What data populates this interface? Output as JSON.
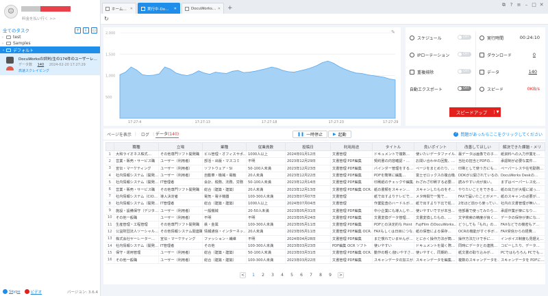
{
  "sidebar": {
    "avatar_glyph": "☺",
    "upgrade_text": "料金を払い行く >>",
    "all_tasks": "全てのタスク",
    "tree": [
      {
        "label": "test"
      },
      {
        "label": "Samples"
      },
      {
        "label": "デフォルト"
      }
    ],
    "task": {
      "title": "DocuWorksの評判(生の174件のユーザーレ…",
      "data_label": "データ数",
      "data_count": "140",
      "timestamp": "2024-02-20 17:27:29",
      "status": "高速スクレイピング"
    },
    "footer": {
      "skype": "Skype",
      "video": "ビデオ",
      "version": "バージョン: 3.6.4"
    }
  },
  "tabs": [
    {
      "label": "ホーム…"
    },
    {
      "label": "実行中-Do…"
    },
    {
      "label": "DocuWorks…"
    }
  ],
  "chart_data": {
    "type": "area",
    "y_ticks": [
      "2,000",
      "1,500",
      "1,000",
      "500"
    ],
    "x_ticks": [
      "17:27:4",
      "17:27:13",
      "17:27:18",
      "17:27:23",
      "17:27:29"
    ],
    "ylim": [
      0,
      2000
    ],
    "color": "#5aa9ec",
    "values": [
      1020,
      1080,
      1200,
      1130,
      1020,
      1000,
      1010,
      1040,
      1200,
      1150,
      1060,
      1020,
      1000,
      1040,
      1110,
      1060,
      1030,
      1080,
      1060,
      1050,
      1100,
      1120,
      1070,
      1080,
      1100,
      1130,
      1160,
      1200,
      1170,
      1120,
      1090,
      1080,
      1110,
      1140,
      1180,
      1230,
      1300,
      1340,
      1290,
      1210,
      1150,
      1100,
      1060,
      1050,
      1020,
      1000,
      980,
      960,
      920,
      900
    ]
  },
  "stats": {
    "schedule": "スケジュール",
    "schedule_toggle": "OFF",
    "runtime_label": "実行時間",
    "runtime_value": "00:24:10",
    "ip_rotation": "IPローテーション",
    "ip_toggle": "OFF",
    "download_label": "ダウンロード",
    "download_value": "0",
    "dedupe": "重複排除",
    "dedupe_toggle": "OFF",
    "data_label": "データ",
    "data_value": "140",
    "auto_export": "自動エクスポート",
    "export_toggle": "OFF",
    "speed_label": "スピード",
    "speed_value": "0KB/s",
    "speedup_button": "スピードアップ"
  },
  "controls": {
    "show_page": "ページを表示",
    "log": "ログ",
    "data_tab": "データ",
    "data_count": "(140)",
    "pause": "一時停止",
    "start": "起動",
    "help": "問題があったらここをクリックしてください"
  },
  "table": {
    "headers": [
      "",
      "職種",
      "立場",
      "業種",
      "従業員数",
      "投稿日",
      "利用用途",
      "タイトル",
      "良いポイント",
      "改善してほしい",
      "解決できた課題・メリ"
    ],
    "rows": [
      [
        "1",
        "大和ライオネス株式…",
        "その他専門ソフト開発職",
        "ビル管理・オフィスサポ…",
        "1000人以上",
        "2024年01月12日",
        "文書管理",
        "ドキュメントで複数…",
        "使いたいデータファイル…",
        "最データは画像での子…",
        "紙資料への入力作業を…"
      ],
      [
        "2",
        "営業・販売・サービス職",
        "ユーザー（利用者）",
        "部活・出版・マスコミ",
        "不明",
        "2023年12月29日",
        "文書管理 PDF編集",
        "契約書の内容確認・…",
        "お問い合わせの回覧、…",
        "当社の担当とPDFの…",
        "承認制が必要な案件…"
      ],
      [
        "3",
        "宣伝・マーケティング",
        "ユーザー（利用者）",
        "ソフトウェア・SI",
        "50-100人未満",
        "2023年12月23日",
        "文書管理 PDF編集",
        "バインダー管理をする…",
        "ページをまとめたり、…",
        "印刷として使う方にも…",
        "ペーパーレスや在宅勤務…"
      ],
      [
        "4",
        "社内情報システム（開発…",
        "ユーザー（利用者）",
        "自動車・機械・電機",
        "20人未満",
        "2023年12月22日",
        "文書管理 PDF編集",
        "PDFを簡単に編集…",
        "富士ゼロックスの複合機…",
        "DDKが公開されているの…",
        "DocuWorks Deskの…"
      ],
      [
        "5",
        "社内情報システム（開発…",
        "IT管理者",
        "会計、税務、法務、労務",
        "50-100人未満",
        "2023年12月14日",
        "文書管理 PDF編集",
        "印刷紙のチェックや編集…",
        "わざわざ印刷する必要…",
        "読みやすい点が良い。",
        "まずはペーパーレス化…"
      ],
      [
        "6",
        "営業・販売・サービス職",
        "その他専門ソフト開発職",
        "総合（建築・建築）",
        "20人未満",
        "2023年12月13日",
        "文書管理 PDF編集 OCR…",
        "紙の書類をスキャン…",
        "スキャンしたものをそ…",
        "やりたいことをできる…",
        "紙の出力が大幅に減っ…"
      ],
      [
        "7",
        "社内情報システム（CIO…",
        "導入決定者",
        "電気・電子機器",
        "100-300人未満",
        "2023年07月07日",
        "文書管理",
        "紙で出すよりテレビで…",
        "メタ時間で一覧で…",
        "FAXで届いたことがメー…",
        "紙のスキャンの必要が…"
      ],
      [
        "8",
        "社内情報システム（開発…",
        "IT管理者",
        "総合（建築・建築）",
        "1000人以上",
        "2024年07月04日",
        "文書管理",
        "作業監査のハードルが…",
        "紙で出すより下比で処…",
        "2年ほど前から使ってい…",
        "社内の文書管理が無い…"
      ],
      [
        "9",
        "施設・設備保守（デジタ…",
        "ユーザー（利用者）",
        "一般機械",
        "20-50人未満",
        "2023年05月31日",
        "文書管理 PDF編集",
        "中小企業にも導入しや…",
        "使いやすいですが本当…",
        "他部署で使ってみたら…",
        "承認作業が楽になり…"
      ],
      [
        "10",
        "その他一般職",
        "ユーザー（利用者）",
        "不明",
        "不明",
        "2023年05月24日",
        "文書管理 PDF編集",
        "文書変換データ管理…",
        "文書変換したもの、…",
        "文字検索の精度が良く…",
        "データの保存が楽にな…"
      ],
      [
        "11",
        "生産管理・工程管理",
        "その他専門ソフト開発職",
        "鉄・金属",
        "100-300人未満",
        "2023年05月11日",
        "文書管理 PDF編集",
        "PDFとの決定的な Point",
        "FujiFilm のDocuWorks…",
        "どうしても「もれ」の…",
        "FAXなどでの機密もア…"
      ],
      [
        "12",
        "公益財団法人ソーシャル…",
        "その他情報システム関連職",
        "情報通信・インターネッ…",
        "20人未満",
        "2023年05月11日",
        "文書管理 PDF編集 OCR…",
        "FAXもしくは日目につな…",
        "紙の保管による保存…",
        "OCRの機能がすぐ手が…",
        "FAX受信からの経費…"
      ],
      [
        "13",
        "株式会社ヤーレーター…",
        "宣伝・マーケティング",
        "ファッション・繊維",
        "不明",
        "2024年04月28日",
        "文書管理 PDF編集",
        "まだ慣れていませんが…",
        "とにかく操作方法が簡…",
        "操作方法だけで手に…",
        "インボイス制度も見据え…"
      ],
      [
        "14",
        "社内情報システム（開発…",
        "IT管理者",
        "その他",
        "100-300人未満",
        "2023年03月23日",
        "PDF編集 OCR ソフト",
        "使いやすい",
        "ドキュメントを開く際…",
        "同時にデータとの連携…",
        "コピーしたり、データ…"
      ],
      [
        "15",
        "保守・運用管理",
        "ユーザー（利用者）",
        "総合（建築・建築）",
        "50-100人未満",
        "2023年03月31日",
        "文書管理 PDF編集 OCR…",
        "動作の軽く/扱いやすさ…",
        "使いやすく、同期的…",
        "紙文書の取り込みが…",
        "PCではもちろん PCでも…"
      ],
      [
        "16",
        "その他一般職",
        "ユーザー（利用者）",
        "総合（建築・建築）",
        "100-300人未満",
        "2023年03月22日",
        "文書管理 PDF編集",
        "スキャンデータの加工が…",
        "スキャンデータを編集…",
        "複数のスキャンデータを…",
        "スキャンデータを PDFに…"
      ]
    ]
  },
  "pager": {
    "prev": "<",
    "next": ">",
    "pages": [
      "1",
      "2",
      "3",
      "4",
      "5",
      "6",
      "7",
      "8",
      "9"
    ]
  }
}
